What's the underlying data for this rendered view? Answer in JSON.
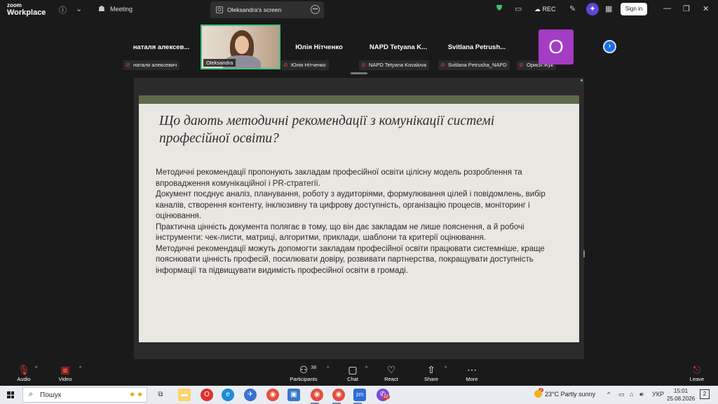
{
  "app": {
    "brand_top": "zoom",
    "brand_bottom": "Workplace",
    "meeting_label": "Meeting",
    "screen_tab_title": "Oleksandra's screen",
    "rec_label": "REC",
    "signin_label": "Sign in"
  },
  "participants": [
    {
      "big": "наталя  алексев...",
      "small": "наталя алексевич"
    },
    {
      "video_label": "Oleksandra"
    },
    {
      "big": "Юлія Нітченко",
      "small": "Юлія Нітченко"
    },
    {
      "big": "NAPD Tetyana K...",
      "small": "NAPD Tetyana Kovalova"
    },
    {
      "big": "Svitlana  Petrush...",
      "small": "Svitlana Petrusha_NAPD"
    },
    {
      "avatar_letter": "О",
      "small": "Орися Жук"
    }
  ],
  "slide": {
    "title": "Що дають методичні рекомендації з комунікації системі професійної освіти?",
    "paragraphs": [
      "Методичні рекомендації пропонують закладам професійної освіти цілісну модель розроблення та впровадження комунікаційної і PR-стратегії.",
      "Документ поєднує аналіз, планування, роботу з аудиторіями, формулювання цілей і повідомлень, вибір каналів, створення контенту, інклюзивну та цифрову доступність, організацію процесів, моніторинг і оцінювання.",
      "Практична цінність документа полягає в тому, що він дає закладам не лише пояснення, а й робочі інструменти: чек-листи, матриці, алгоритми, приклади, шаблони та критерії оцінювання.",
      "Методичні рекомендації можуть допомогти закладам професійної освіти працювати системніше, краще пояснювати цінність професій, посилювати довіру, розвивати партнерства, покращувати доступність інформації та підвищувати видимість професійної освіти в громаді."
    ]
  },
  "toolbar": {
    "audio": "Audio",
    "video": "Video",
    "participants": "Participants",
    "participants_count": "38",
    "chat": "Chat",
    "react": "React",
    "share": "Share",
    "more": "More",
    "leave": "Leave"
  },
  "taskbar": {
    "search_placeholder": "Пошук",
    "zoom_badge": "22",
    "weather_badge": "2",
    "weather": "23°C  Partly sunny",
    "lang": "УКР",
    "time": "15:01",
    "date": "25.08.2026",
    "notif_count": "2"
  }
}
